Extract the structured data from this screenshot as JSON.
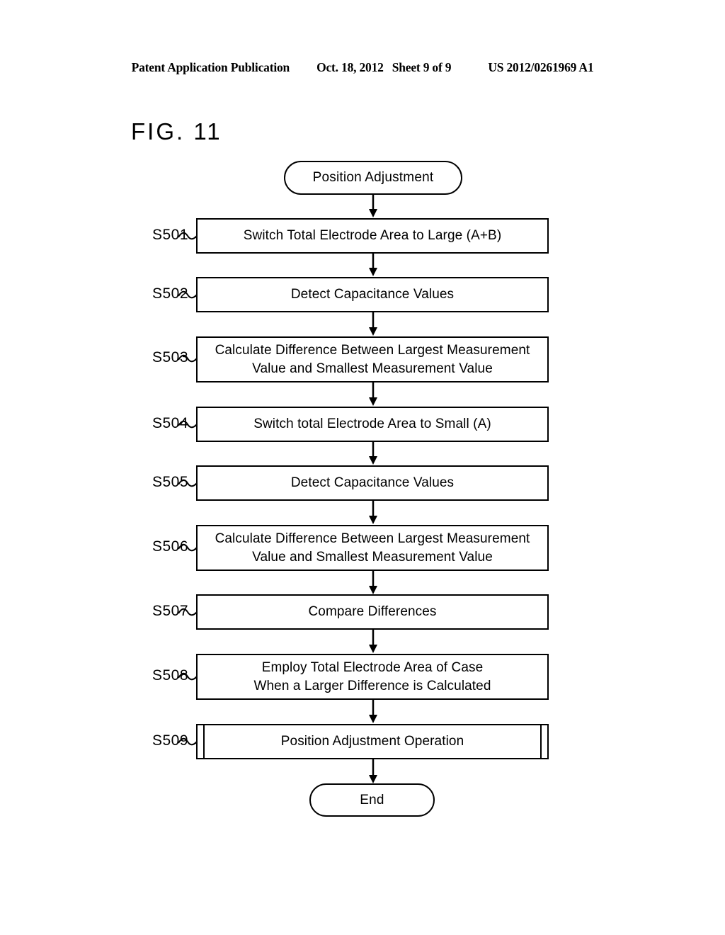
{
  "header": {
    "publication": "Patent Application Publication",
    "date": "Oct. 18, 2012",
    "sheet": "Sheet 9 of 9",
    "number": "US 2012/0261969 A1"
  },
  "figure": {
    "label": "FIG. 11"
  },
  "flowchart": {
    "start": {
      "label": "Position Adjustment"
    },
    "end": {
      "label": "End"
    },
    "steps": [
      {
        "id": "S501",
        "text": "Switch Total Electrode Area to Large (A+B)",
        "type": "process"
      },
      {
        "id": "S502",
        "text": "Detect Capacitance Values",
        "type": "process"
      },
      {
        "id": "S503",
        "line1": "Calculate Difference Between Largest Measurement",
        "line2": "Value and Smallest Measurement Value",
        "type": "process"
      },
      {
        "id": "S504",
        "text": "Switch total Electrode Area to Small (A)",
        "type": "process"
      },
      {
        "id": "S505",
        "text": "Detect Capacitance Values",
        "type": "process"
      },
      {
        "id": "S506",
        "line1": "Calculate Difference Between Largest Measurement",
        "line2": "Value and Smallest Measurement Value",
        "type": "process"
      },
      {
        "id": "S507",
        "text": "Compare Differences",
        "type": "process"
      },
      {
        "id": "S508",
        "line1": "Employ Total Electrode Area of Case",
        "line2": "When a Larger Difference is Calculated",
        "type": "process"
      },
      {
        "id": "S509",
        "text": "Position Adjustment Operation",
        "type": "predefined-process"
      }
    ]
  },
  "colors": {
    "ink": "#000000",
    "paper": "#ffffff"
  }
}
